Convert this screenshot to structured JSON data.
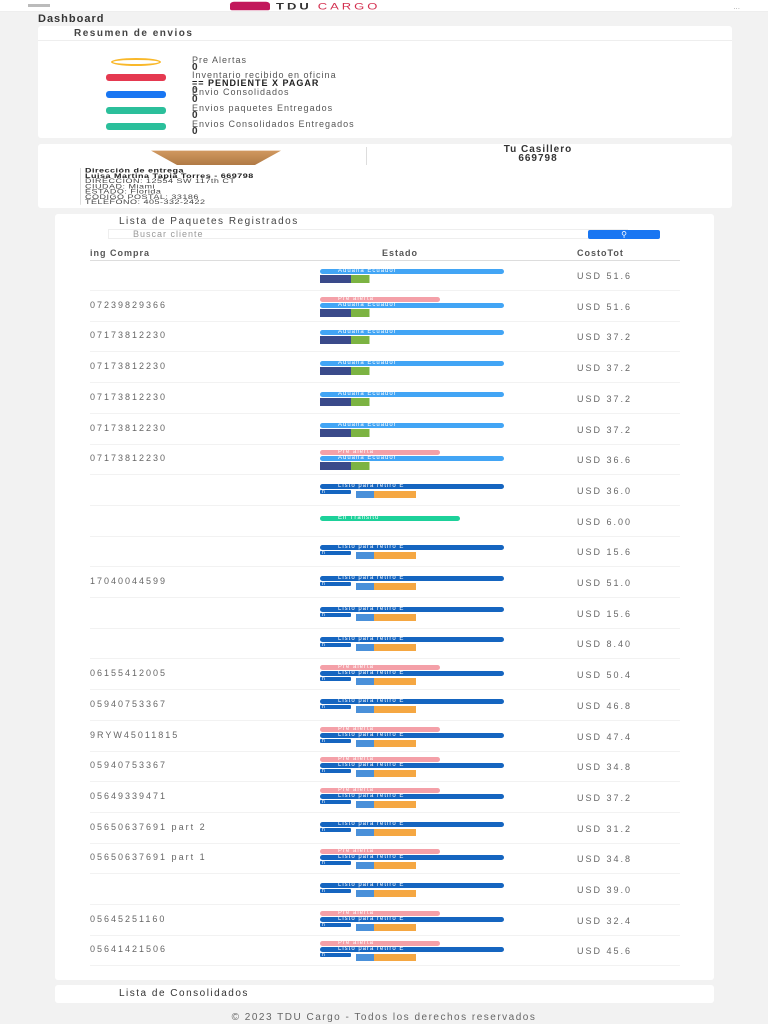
{
  "header": {
    "brand_a": "TDU",
    "brand_b": "CARGO",
    "menu": "..."
  },
  "page_title": "Dashboard",
  "summary": {
    "title": "Resumen de envios",
    "items": [
      {
        "label": "Pre Alertas",
        "sub": "",
        "value": "0",
        "icon": "clock-icon",
        "color": "#f9b82a"
      },
      {
        "label": "Inventario recibido en oficina",
        "sub": "== PENDIENTE X PAGAR",
        "value": "0",
        "icon": "inbox-icon",
        "color": "#e53950"
      },
      {
        "label": "Envio Consolidados",
        "sub": "",
        "value": "0",
        "icon": "consolidated-box-icon",
        "color": "#1976f2"
      },
      {
        "label": "Envios paquetes Entregados",
        "sub": "",
        "value": "0",
        "icon": "delivered-plane-icon",
        "color": "#2bbf9b"
      },
      {
        "label": "Envios Consolidados Entregados",
        "sub": "",
        "value": "0",
        "icon": "delivered-plane-icon",
        "color": "#2bbf9b"
      }
    ]
  },
  "locker": {
    "title": "Tu Casillero",
    "number": "669798"
  },
  "address": {
    "title": "Dirección de entrega",
    "name": "Luisa Martina Tapia Torres - 669798",
    "lines": [
      "DIRECCION: 12554 SW 117th CT",
      "CIUDAD: Miami",
      "ESTADO: Florida",
      "CODIGO POSTAL: 33186",
      "TELEFONO: 405-332-2422"
    ]
  },
  "packages": {
    "title": "Lista de Paquetes Registrados",
    "search_placeholder": "Buscar cliente",
    "columns": [
      "ing Compra",
      "Estado",
      "CostoTot"
    ],
    "rows": [
      {
        "tracking": "",
        "badges": [
          "Aduana Ecuador"
        ],
        "amount": "USD 51.6"
      },
      {
        "tracking": "07239829366",
        "badges": [
          "Pre alerta",
          "Aduana Ecuador"
        ],
        "amount": "USD 51.6"
      },
      {
        "tracking": "07173812230",
        "badges": [
          "Aduana Ecuador"
        ],
        "amount": "USD 37.2"
      },
      {
        "tracking": "07173812230",
        "badges": [
          "Aduana Ecuador"
        ],
        "amount": "USD 37.2"
      },
      {
        "tracking": "07173812230",
        "badges": [
          "Aduana Ecuador"
        ],
        "amount": "USD 37.2"
      },
      {
        "tracking": "07173812230",
        "badges": [
          "Aduana Ecuador"
        ],
        "amount": "USD 37.2"
      },
      {
        "tracking": "07173812230",
        "badges": [
          "Pre alerta",
          "Aduana Ecuador"
        ],
        "amount": "USD 36.6"
      },
      {
        "tracking": "",
        "badges": [
          "Listo para retiro E"
        ],
        "amount": "USD 36.0"
      },
      {
        "tracking": "",
        "badges": [
          "En Transito"
        ],
        "amount": "USD 6.00"
      },
      {
        "tracking": "",
        "badges": [
          "Listo para retiro E"
        ],
        "amount": "USD 15.6"
      },
      {
        "tracking": "17040044599",
        "badges": [
          "Listo para retiro E"
        ],
        "amount": "USD 51.0"
      },
      {
        "tracking": "",
        "badges": [
          "Listo para retiro E"
        ],
        "amount": "USD 15.6"
      },
      {
        "tracking": "",
        "badges": [
          "Listo para retiro E"
        ],
        "amount": "USD 8.40"
      },
      {
        "tracking": "06155412005",
        "badges": [
          "Pre alerta",
          "Listo para retiro E"
        ],
        "amount": "USD 50.4"
      },
      {
        "tracking": "05940753367",
        "badges": [
          "Listo para retiro E"
        ],
        "amount": "USD 46.8"
      },
      {
        "tracking": "9RYW45011815",
        "badges": [
          "Pre alerta",
          "Listo para retiro E"
        ],
        "amount": "USD 47.4"
      },
      {
        "tracking": "05940753367",
        "badges": [
          "Pre alerta",
          "Listo para retiro E"
        ],
        "amount": "USD 34.8"
      },
      {
        "tracking": "05649339471",
        "badges": [
          "Pre alerta",
          "Listo para retiro E"
        ],
        "amount": "USD 37.2"
      },
      {
        "tracking": "05650637691 part 2",
        "badges": [
          "Listo para retiro E"
        ],
        "amount": "USD 31.2"
      },
      {
        "tracking": "05650637691 part 1",
        "badges": [
          "Pre alerta",
          "Listo para retiro E"
        ],
        "amount": "USD 34.8"
      },
      {
        "tracking": "",
        "badges": [
          "Listo para retiro E"
        ],
        "amount": "USD 39.0"
      },
      {
        "tracking": "05645251160",
        "badges": [
          "Pre alerta",
          "Listo para retiro E"
        ],
        "amount": "USD 32.4"
      },
      {
        "tracking": "05641421506",
        "badges": [
          "Pre alerta",
          "Listo para retiro E"
        ],
        "amount": "USD 45.6"
      }
    ],
    "listo_suffix": "n"
  },
  "consolidated": {
    "title": "Lista de Consolidados"
  },
  "footer": "© 2023 TDU Cargo - Todos los derechos reservados"
}
